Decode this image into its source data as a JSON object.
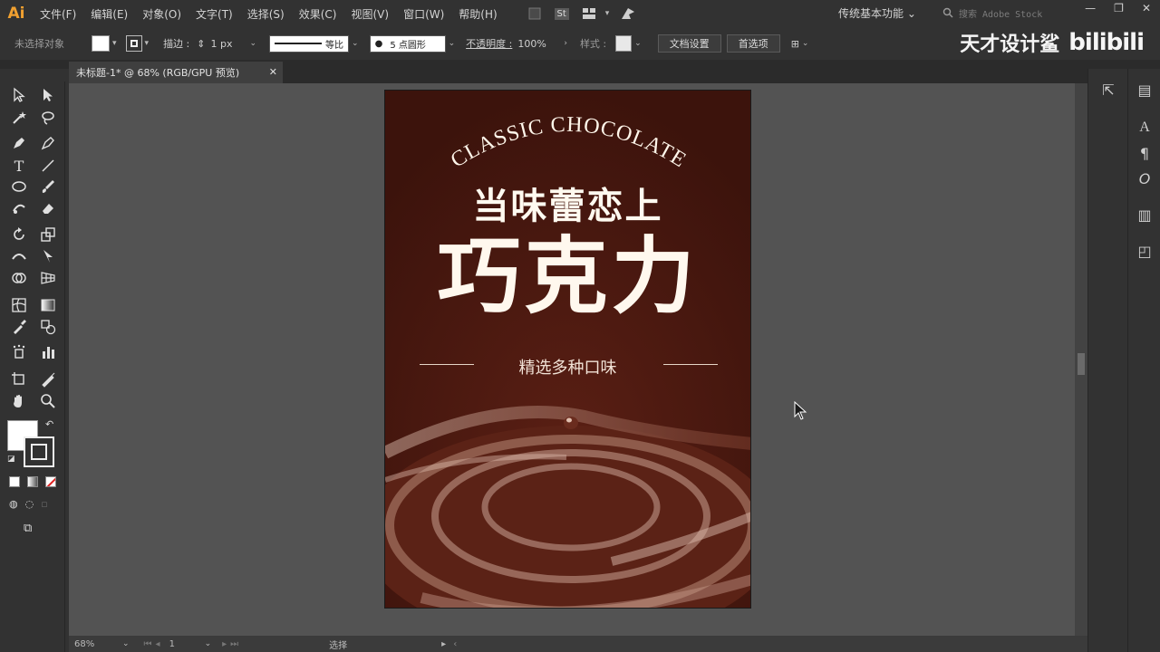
{
  "app": {
    "logo": "Ai",
    "menus": [
      "文件(F)",
      "编辑(E)",
      "对象(O)",
      "文字(T)",
      "选择(S)",
      "效果(C)",
      "视图(V)",
      "窗口(W)",
      "帮助(H)"
    ],
    "stock_badge": "St",
    "workspace": "传统基本功能",
    "search_placeholder": "搜索 Adobe Stock",
    "window_controls": [
      "—",
      "❐",
      "✕"
    ]
  },
  "control_bar": {
    "selection_label": "未选择对象",
    "stroke_label": "描边 :",
    "stroke_weight": "1 px",
    "stroke_profile": "等比",
    "brush": "5 点圆形",
    "opacity_label": "不透明度 :",
    "opacity_value": "100%",
    "style_label": "样式 :",
    "doc_setup": "文档设置",
    "preferences": "首选项"
  },
  "branding": {
    "channel": "天才设计鲨",
    "site": "bilibili"
  },
  "document": {
    "tab_title": "未标题-1* @ 68% (RGB/GPU 预览)",
    "close": "✕"
  },
  "artboard": {
    "arc_text": "CLASSIC CHOCOLATE",
    "headline": "当味蕾恋上",
    "title": "巧克力",
    "subtitle": "精选多种口味",
    "bg_color": "#4a1810"
  },
  "status": {
    "zoom": "68%",
    "artboard_num": "1",
    "mode": "选择"
  },
  "tools": [
    [
      "selection-tool",
      "direct-selection-tool"
    ],
    [
      "magic-wand-tool",
      "lasso-tool"
    ],
    [
      "pen-tool",
      "curvature-tool"
    ],
    [
      "type-tool",
      "line-segment-tool"
    ],
    [
      "ellipse-tool",
      "paintbrush-tool"
    ],
    [
      "shaper-tool",
      "eraser-tool"
    ],
    [
      "rotate-tool",
      "scale-tool"
    ],
    [
      "width-tool",
      "puppet-warp-tool"
    ],
    [
      "shape-builder-tool",
      "perspective-grid-tool"
    ],
    [
      "mesh-tool",
      "gradient-tool"
    ],
    [
      "eyedropper-tool",
      "blend-tool"
    ],
    [
      "symbol-sprayer-tool",
      "column-graph-tool"
    ],
    [
      "artboard-tool",
      "slice-tool"
    ],
    [
      "hand-tool",
      "zoom-tool"
    ]
  ]
}
